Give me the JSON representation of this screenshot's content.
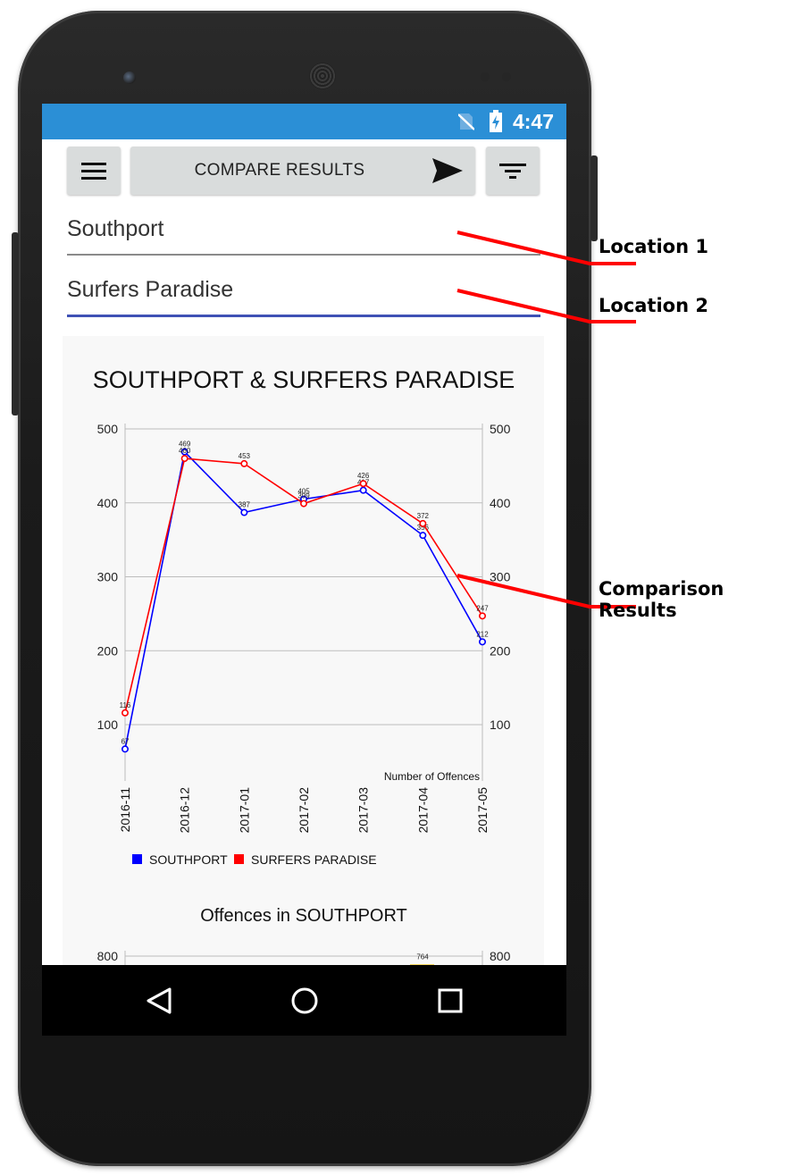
{
  "status_bar": {
    "time": "4:47"
  },
  "toolbar": {
    "compare_label": "COMPARE RESULTS"
  },
  "inputs": {
    "location1_value": "Southport",
    "location2_value": "Surfers Paradise"
  },
  "annotations": {
    "location1": "Location 1",
    "location2": "Location 2",
    "comparison": "Comparison Results"
  },
  "colors": {
    "status_bar": "#2b8fd6",
    "southport": "#0000ff",
    "surfers_paradise": "#ff0000",
    "bar": "#f2c200",
    "annotation_line": "#ff0000",
    "active_underline": "#3f51b5"
  },
  "chart_data": [
    {
      "type": "line",
      "title": "SOUTHPORT & SURFERS PARADISE",
      "x": [
        "2016-11",
        "2016-12",
        "2017-01",
        "2017-02",
        "2017-03",
        "2017-04",
        "2017-05"
      ],
      "series": [
        {
          "name": "SOUTHPORT",
          "values": [
            67,
            469,
            387,
            405,
            417,
            356,
            212
          ]
        },
        {
          "name": "SURFERS PARADISE",
          "values": [
            116,
            460,
            453,
            399,
            426,
            372,
            247
          ]
        }
      ],
      "point_labels": {
        "SOUTHPORT": [
          "67",
          "469",
          "387",
          "405",
          "417",
          "356",
          "212"
        ],
        "SURFERS PARADISE": [
          "116",
          "460",
          "453",
          "399",
          "426",
          "372",
          "247"
        ]
      },
      "ylim": [
        34,
        500
      ],
      "y_ticks": [
        100,
        200,
        300,
        400,
        500
      ],
      "xlabel": "",
      "ylabel": "",
      "annotation": "Number of Offences",
      "grid": true,
      "legend": "bottom-left"
    },
    {
      "type": "bar",
      "title": "Offences in SOUTHPORT",
      "y_ticks": [
        800
      ],
      "visible_bars": [
        {
          "value": 764,
          "label": "764",
          "color": "#f2c200"
        }
      ]
    }
  ],
  "navigation": {
    "back_icon": "triangle-back-icon",
    "home_icon": "circle-home-icon",
    "recents_icon": "square-recents-icon"
  }
}
